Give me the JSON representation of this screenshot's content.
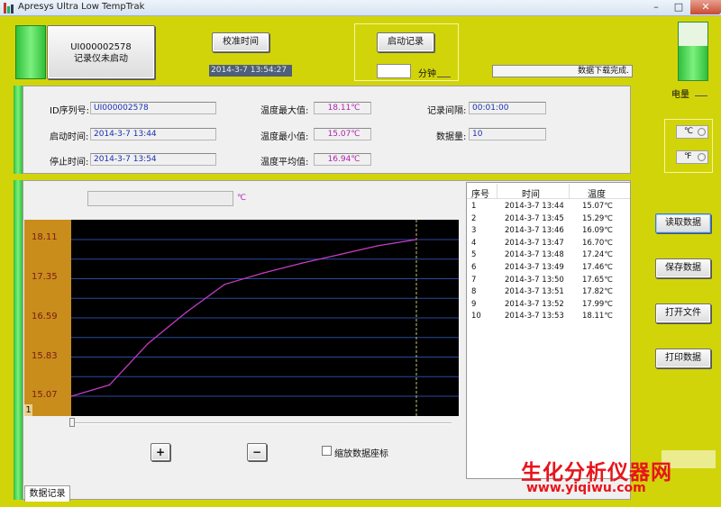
{
  "window": {
    "title": "Apresys Ultra Low TempTrak",
    "minimize": "–",
    "maximize": "□",
    "close": "✕"
  },
  "device": {
    "id_line": "UI000002578",
    "status_line": "记录仪未启动"
  },
  "calibrate_button": "校准时间",
  "current_time": "2014-3-7 13:54:27",
  "start_record_button": "启动记录",
  "minutes_input": "",
  "minutes_label": "分钟",
  "status_message": "数据下载完成.",
  "battery_label": "电量",
  "info": {
    "id_label": "ID序列号:",
    "id_value": "UI000002578",
    "start_label": "启动时间:",
    "start_value": "2014-3-7  13:44",
    "stop_label": "停止时间:",
    "stop_value": "2014-3-7  13:54",
    "tmax_label": "温度最大值:",
    "tmax_value": "18.11℃",
    "tmin_label": "温度最小值:",
    "tmin_value": "15.07℃",
    "tavg_label": "温度平均值:",
    "tavg_value": "16.94℃",
    "interval_label": "记录间隔:",
    "interval_value": "00:01:00",
    "count_label": "数据量:",
    "count_value": "10"
  },
  "units": {
    "celsius": "℃",
    "fahrenheit": "℉"
  },
  "chart_unit": "℃",
  "chart_marker": "1",
  "zoom_in_icon": "+",
  "zoom_out_icon": "−",
  "scale_checkbox_label": "缩放数据座标",
  "tab_label": "数据记录",
  "table": {
    "headers": [
      "序号",
      "时间",
      "温度"
    ],
    "rows": [
      [
        "1",
        "2014-3-7 13:44",
        "15.07℃"
      ],
      [
        "2",
        "2014-3-7 13:45",
        "15.29℃"
      ],
      [
        "3",
        "2014-3-7 13:46",
        "16.09℃"
      ],
      [
        "4",
        "2014-3-7 13:47",
        "16.70℃"
      ],
      [
        "5",
        "2014-3-7 13:48",
        "17.24℃"
      ],
      [
        "6",
        "2014-3-7 13:49",
        "17.46℃"
      ],
      [
        "7",
        "2014-3-7 13:50",
        "17.65℃"
      ],
      [
        "8",
        "2014-3-7 13:51",
        "17.82℃"
      ],
      [
        "9",
        "2014-3-7 13:52",
        "17.99℃"
      ],
      [
        "10",
        "2014-3-7 13:53",
        "18.11℃"
      ]
    ]
  },
  "buttons": {
    "read": "读取数据",
    "save": "保存数据",
    "open": "打开文件",
    "print": "打印数据"
  },
  "watermark": {
    "cn": "生化分析仪器网",
    "url": "www.yiqiwu.com"
  },
  "chart_data": {
    "type": "line",
    "x": [
      "13:44",
      "13:45",
      "13:46",
      "13:47",
      "13:48",
      "13:49",
      "13:50",
      "13:51",
      "13:52",
      "13:53"
    ],
    "values": [
      15.07,
      15.29,
      16.09,
      16.7,
      17.24,
      17.46,
      17.65,
      17.82,
      17.99,
      18.11
    ],
    "yticks": [
      "18.11",
      "17.35",
      "16.59",
      "15.83",
      "15.07"
    ],
    "ylim": [
      15.07,
      18.11
    ],
    "grid": true,
    "colors": {
      "line": "#c43cc4",
      "grid": "#2a4aa0",
      "background": "#000000",
      "axis": "#c98d1b",
      "cursor": "#c9c27a"
    }
  }
}
